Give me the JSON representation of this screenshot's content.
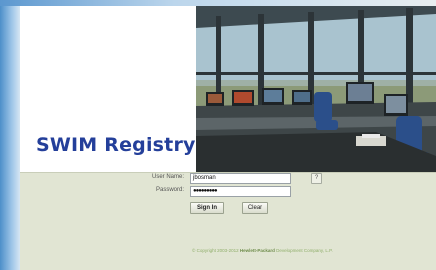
{
  "brand": {
    "title": "SWIM Registry"
  },
  "login": {
    "username_label": "User Name:",
    "username_value": "jbosman",
    "password_label": "Password:",
    "password_value": "●●●●●●●●●",
    "help_label": "?",
    "signin_label": "Sign In",
    "clear_label": "Clear"
  },
  "footer": {
    "copyright_prefix": "© Copyright 2003-2012",
    "copyright_company": "Hewlett-Packard",
    "copyright_suffix": "Development Company, L.P."
  },
  "colors": {
    "title": "#243f9a",
    "background": "#e1e5d3",
    "copyright": "#8fae6a"
  }
}
